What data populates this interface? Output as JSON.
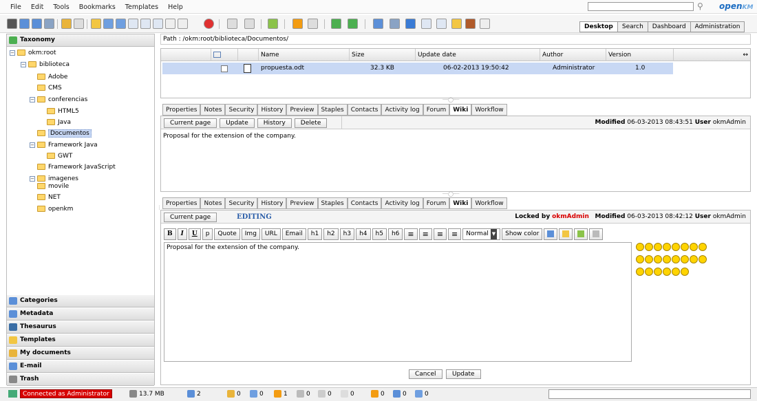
{
  "menubar": {
    "items": [
      "File",
      "Edit",
      "Tools",
      "Bookmarks",
      "Templates",
      "Help"
    ]
  },
  "logo": {
    "main": "open",
    "suffix": "KM"
  },
  "workspace_tabs": [
    {
      "label": "Desktop",
      "active": true
    },
    {
      "label": "Search",
      "active": false
    },
    {
      "label": "Dashboard",
      "active": false
    },
    {
      "label": "Administration",
      "active": false
    }
  ],
  "left": {
    "taxonomy_title": "Taxonomy",
    "tree": [
      {
        "label": "okm:root",
        "level": 0,
        "toggle": "⊟"
      },
      {
        "label": "biblioteca",
        "level": 1,
        "toggle": "⊟"
      },
      {
        "label": "Adobe",
        "level": 2,
        "toggle": ""
      },
      {
        "label": "CMS",
        "level": 2,
        "toggle": ""
      },
      {
        "label": "conferencias",
        "level": 2,
        "toggle": "⊟"
      },
      {
        "label": "HTML5",
        "level": 3,
        "toggle": ""
      },
      {
        "label": "Java",
        "level": 3,
        "toggle": ""
      },
      {
        "label": "Documentos",
        "level": 2,
        "toggle": "",
        "selected": true
      },
      {
        "label": "Framework Java",
        "level": 2,
        "toggle": "⊟"
      },
      {
        "label": "GWT",
        "level": 3,
        "toggle": ""
      },
      {
        "label": "Framework JavaScript",
        "level": 2,
        "toggle": ""
      },
      {
        "label": "imagenes",
        "level": 2,
        "toggle": "⊟"
      },
      {
        "label": "movile",
        "level": 2,
        "toggle": ""
      },
      {
        "label": "NET",
        "level": 2,
        "toggle": ""
      },
      {
        "label": "openkm",
        "level": 2,
        "toggle": ""
      }
    ],
    "stacks": [
      "Categories",
      "Metadata",
      "Thesaurus",
      "Templates",
      "My documents",
      "E-mail",
      "Trash"
    ]
  },
  "path": "Path : /okm:root/biblioteca/Documentos/",
  "grid": {
    "headers": {
      "name": "Name",
      "size": "Size",
      "date": "Update date",
      "author": "Author",
      "version": "Version"
    },
    "rows": [
      {
        "name": "propuesta.odt",
        "size": "32.3 KB",
        "date": "06-02-2013 19:50:42",
        "author": "Administrator",
        "version": "1.0"
      }
    ]
  },
  "tabs": [
    "Properties",
    "Notes",
    "Security",
    "History",
    "Preview",
    "Staples",
    "Contacts",
    "Activity log",
    "Forum",
    "Wiki",
    "Workflow"
  ],
  "active_tab": "Wiki",
  "wiki_top": {
    "buttons": [
      "Current page",
      "Update",
      "History",
      "Delete"
    ],
    "modified_label": "Modified",
    "modified_date": "06-03-2013 08:43:51",
    "user_label": "User",
    "user": "okmAdmin",
    "content": "Proposal for the extension of the company."
  },
  "wiki_bottom": {
    "current_page": "Current page",
    "editing": "EDITING",
    "locked_label": "Locked by",
    "locked_user": "okmAdmin",
    "modified_label": "Modified",
    "modified_date": "06-03-2013 08:42:12",
    "user_label": "User",
    "user": "okmAdmin",
    "editor_buttons": [
      "B",
      "I",
      "U",
      "p",
      "Quote",
      "Img",
      "URL",
      "Email",
      "h1",
      "h2",
      "h3",
      "h4",
      "h5",
      "h6"
    ],
    "format_select": "Normal",
    "show_color": "Show color",
    "content": "Proposal for the extension of the company.",
    "cancel": "Cancel",
    "update": "Update"
  },
  "status": {
    "connected": "Connected as Administrator",
    "memory": "13.7 MB",
    "counts": [
      "2",
      "0",
      "0",
      "1",
      "0",
      "0",
      "0",
      "0",
      "0",
      "0"
    ]
  },
  "colors": {
    "accent": "#1b6cc2",
    "selection": "#c8d8f4",
    "locked_user": "#d80000",
    "status_conn": "#d80000"
  }
}
